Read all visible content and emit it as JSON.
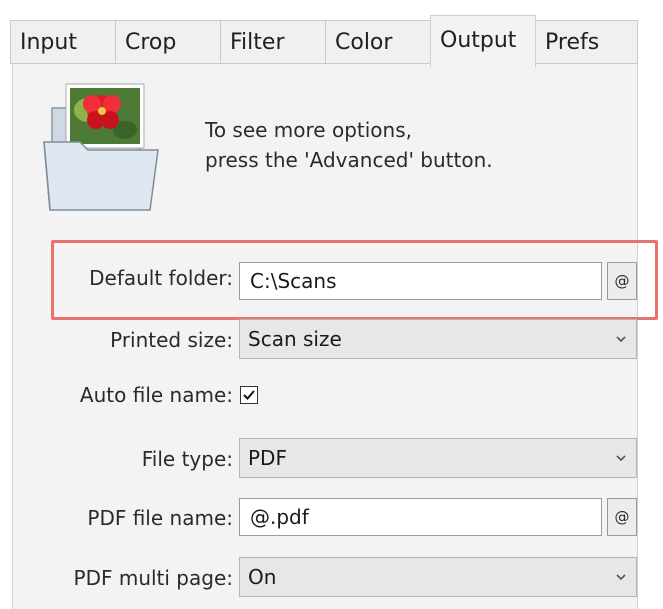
{
  "tabs": [
    {
      "label": "Input",
      "active": false
    },
    {
      "label": "Crop",
      "active": false
    },
    {
      "label": "Filter",
      "active": false
    },
    {
      "label": "Color",
      "active": false
    },
    {
      "label": "Output",
      "active": true
    },
    {
      "label": "Prefs",
      "active": false
    }
  ],
  "hint": {
    "line1": "To see more options,",
    "line2": "press the 'Advanced' button."
  },
  "form": {
    "default_folder": {
      "label": "Default folder:",
      "value": "C:\\Scans",
      "button": "@"
    },
    "printed_size": {
      "label": "Printed size:",
      "value": "Scan size"
    },
    "auto_file_name": {
      "label": "Auto file name:",
      "checked": true
    },
    "file_type": {
      "label": "File type:",
      "value": "PDF"
    },
    "pdf_file_name": {
      "label": "PDF file name:",
      "value": "@.pdf",
      "button": "@"
    },
    "pdf_multi_page": {
      "label": "PDF multi page:",
      "value": "On"
    }
  },
  "icons": {
    "illustration": "folder-with-photo-icon",
    "dropdown": "chevron-down-icon",
    "checkbox": "checkmark-icon"
  },
  "colors": {
    "highlight": "#e8736b",
    "panel": "#f3f3f3"
  }
}
